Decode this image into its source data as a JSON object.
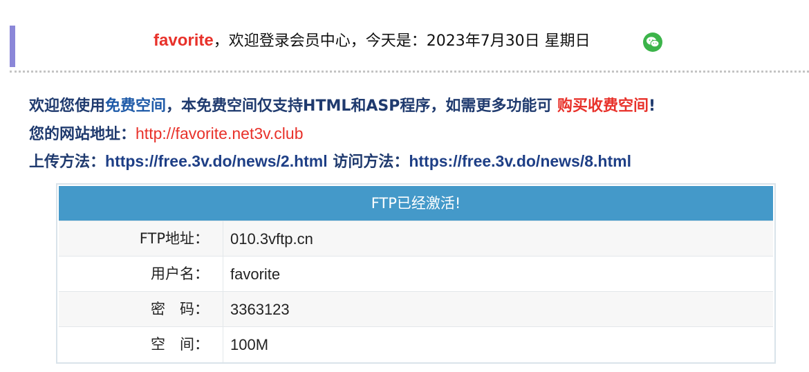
{
  "header": {
    "username": "favorite",
    "greeting": "，欢迎登录会员中心，今天是：2023年7月30日 星期日"
  },
  "info": {
    "line1_prefix": "欢迎您使用",
    "line1_free": "免费空间",
    "line1_mid": "，本免费空间仅支持HTML和ASP程序，如需更多功能可 ",
    "line1_buy": "购买收费空间",
    "line1_end": "!",
    "line2_label": "您的网站地址：",
    "line2_url": "http://favorite.net3v.club",
    "line3_upload_label": "上传方法：",
    "line3_upload_url": "https://free.3v.do/news/2.html",
    "line3_visit_label": " 访问方法：",
    "line3_visit_url": "https://free.3v.do/news/8.html"
  },
  "ftp": {
    "title": "FTP已经激活!",
    "rows": [
      {
        "label": "FTP地址：",
        "value": "010.3vftp.cn"
      },
      {
        "label": "用户名：",
        "value": "favorite"
      },
      {
        "label": "密　码：",
        "value": "3363123"
      },
      {
        "label": "空　间：",
        "value": "100M"
      }
    ]
  },
  "icons": {
    "wechat": "wechat-icon"
  },
  "colors": {
    "accent_red": "#e8312a",
    "table_header": "#4499c9",
    "wechat_green": "#3cb44a"
  }
}
